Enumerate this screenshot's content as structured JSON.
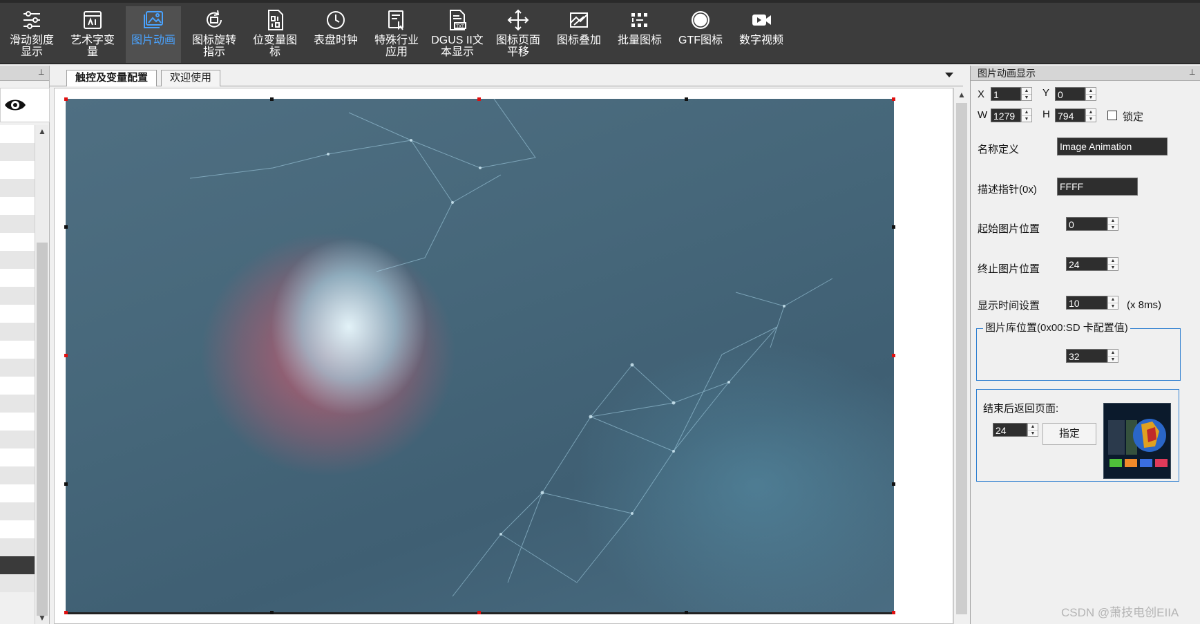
{
  "toolbar": {
    "items": [
      {
        "label": "滑动刻度\n显示",
        "icon": "slider-scale-icon"
      },
      {
        "label": "艺术字变\n量",
        "icon": "art-text-icon"
      },
      {
        "label": "图片动画",
        "icon": "image-animation-icon",
        "active": true
      },
      {
        "label": "图标旋转\n指示",
        "icon": "icon-rotate-icon"
      },
      {
        "label": "位变量图\n标",
        "icon": "bit-variable-icon"
      },
      {
        "label": "表盘时钟",
        "icon": "clock-icon"
      },
      {
        "label": "特殊行业\n应用",
        "icon": "industry-app-icon"
      },
      {
        "label": "DGUS II文\n本显示",
        "icon": "text-display-icon"
      },
      {
        "label": "图标页面\n平移",
        "icon": "move-arrows-icon"
      },
      {
        "label": "图标叠加",
        "icon": "icon-overlay-icon"
      },
      {
        "label": "批量图标",
        "icon": "batch-icon"
      },
      {
        "label": "GTF图标",
        "icon": "gtf-icon"
      },
      {
        "label": "数字视频",
        "icon": "video-camera-icon"
      }
    ]
  },
  "tabs": {
    "active": "触控及变量配置",
    "welcome": "欢迎使用"
  },
  "properties": {
    "panel_title": "图片动画显示",
    "x_label": "X",
    "x": "1",
    "y_label": "Y",
    "y": "0",
    "w_label": "W",
    "w": "1279",
    "h_label": "H",
    "h": "794",
    "lock_label": "锁定",
    "name_label": "名称定义",
    "name_value": "Image Animation",
    "desc_ptr_label": "描述指针(0x)",
    "desc_ptr_value": "FFFF",
    "start_label": "起始图片位置",
    "start_value": "0",
    "end_label": "终止图片位置",
    "end_value": "24",
    "time_label": "显示时间设置",
    "time_value": "10",
    "time_unit": "(x 8ms)",
    "lib_group_title": "图片库位置(0x00:SD 卡配置值)",
    "lib_value": "32",
    "return_label": "结束后返回页面:",
    "return_value": "24",
    "assign_button": "指定"
  },
  "watermark": "CSDN @萧技电创EIIA"
}
